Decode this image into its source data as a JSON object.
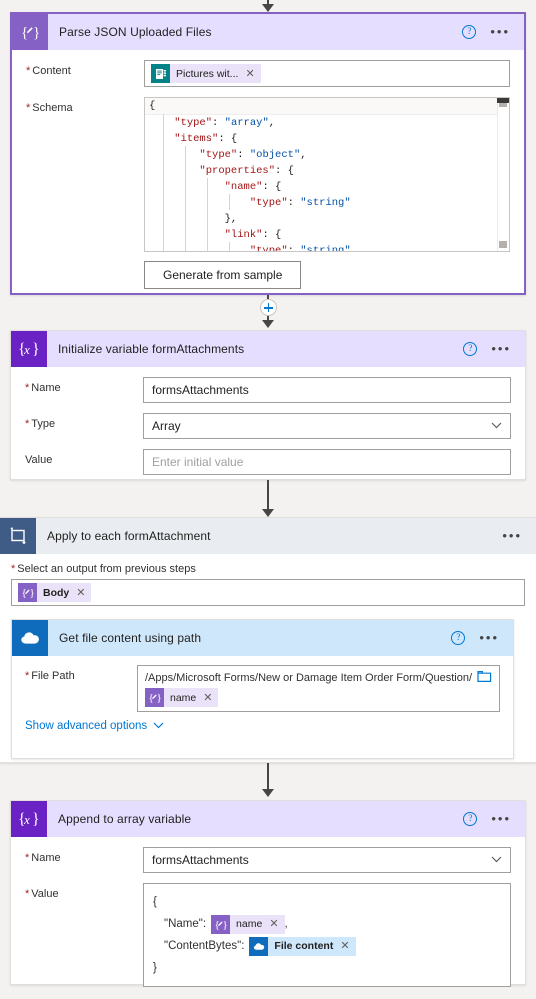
{
  "flow": {
    "connectors": {
      "insert_plus_label": "+"
    },
    "cards": [
      {
        "id": "parse-json",
        "title": "Parse JSON Uploaded Files",
        "icon": "expression-braces-pen-icon",
        "help_label": "?",
        "more_label": "•••",
        "fields": {
          "content": {
            "label": "Content",
            "required": true,
            "token": {
              "icon": "microsoft-forms-icon",
              "label": "Pictures wit...",
              "remove_label": "✕"
            }
          },
          "schema": {
            "label": "Schema",
            "required": true,
            "code_lines": [
              "{",
              "    \"type\": \"array\",",
              "    \"items\": {",
              "        \"type\": \"object\",",
              "        \"properties\": {",
              "            \"name\": {",
              "                \"type\": \"string\"",
              "            },",
              "            \"link\": {",
              "                \"type\": \"string\""
            ]
          },
          "generate_button": "Generate from sample"
        }
      },
      {
        "id": "initialize-variable",
        "title": "Initialize variable formAttachments",
        "icon": "variable-braces-x-icon",
        "help_label": "?",
        "more_label": "•••",
        "fields": {
          "name": {
            "label": "Name",
            "required": true,
            "value": "formsAttachments"
          },
          "type": {
            "label": "Type",
            "required": true,
            "value": "Array",
            "chevron": "⌄"
          },
          "value": {
            "label": "Value",
            "required": false,
            "placeholder": "Enter initial value"
          }
        }
      },
      {
        "id": "apply-to-each",
        "title": "Apply to each formAttachment",
        "icon": "loop-repeat-icon",
        "more_label": "•••",
        "output_label": "Select an output from previous steps",
        "output_required": true,
        "output_token": {
          "icon": "expression-icon",
          "label": "Body",
          "remove_label": "✕"
        },
        "nested": {
          "id": "get-file-content",
          "title": "Get file content using path",
          "icon": "onedrive-icon",
          "help_label": "?",
          "more_label": "•••",
          "file_path": {
            "label": "File Path",
            "required": true,
            "text": "/Apps/Microsoft Forms/New or Damage Item Order Form/Question/",
            "token": {
              "icon": "expression-icon",
              "label": "name",
              "remove_label": "✕"
            },
            "browse_icon": "folder-icon"
          },
          "advanced_link": "Show advanced options",
          "advanced_chevron": "⌄"
        }
      },
      {
        "id": "append-to-array",
        "title": "Append to array variable",
        "icon": "variable-braces-x-icon",
        "help_label": "?",
        "more_label": "•••",
        "fields": {
          "name": {
            "label": "Name",
            "required": true,
            "value": "formsAttachments",
            "chevron": "⌄"
          },
          "value": {
            "label": "Value",
            "required": true,
            "line_open": "{",
            "name_key": "\"Name\":",
            "name_token": {
              "icon": "expression-icon",
              "label": "name",
              "remove_label": "✕"
            },
            "name_comma": ",",
            "content_key": "\"ContentBytes\":",
            "content_token": {
              "icon": "onedrive-icon",
              "label": "File content",
              "remove_label": "✕"
            },
            "line_close": "}"
          }
        }
      }
    ]
  },
  "colors": {
    "accent_purple": "#8661c5",
    "accent_deep_purple": "#6b22c4",
    "onedrive_blue": "#0f6cbd",
    "forms_teal": "#038387",
    "loop_slate": "#3e5c86",
    "link_blue": "#0078d4",
    "required_red": "#a4262c",
    "code_key": "#a31515",
    "code_value": "#0451a5"
  }
}
